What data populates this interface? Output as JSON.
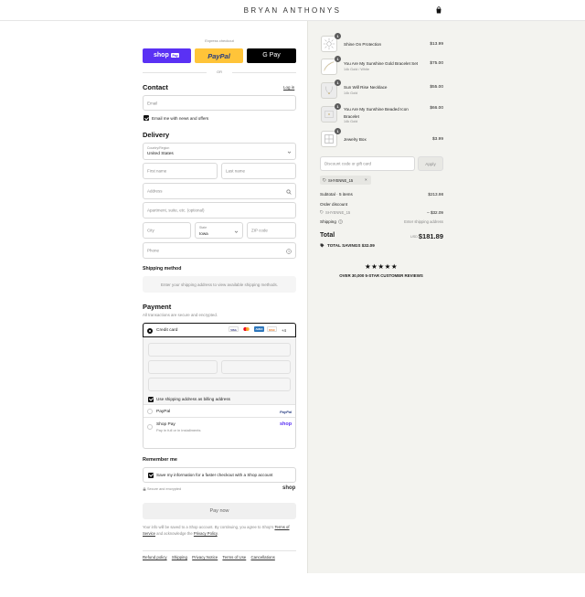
{
  "header": {
    "brand": "BRYAN ANTHONYS",
    "bag_icon": "shopping-bag-icon"
  },
  "express": {
    "label": "Express checkout",
    "shop_pay": "shop",
    "shop_pay_badge": "Pay",
    "paypal": "PayPal",
    "gpay": "G Pay",
    "or": "OR"
  },
  "contact": {
    "title": "Contact",
    "login": "Log in",
    "email_placeholder": "Email",
    "email_news": "Email me with news and offers"
  },
  "delivery": {
    "title": "Delivery",
    "country_label": "Country/Region",
    "country_value": "United States",
    "first_name": "First name",
    "last_name": "Last name",
    "address": "Address",
    "apartment": "Apartment, suite, etc. (optional)",
    "city": "City",
    "state_label": "State",
    "state_value": "Iowa",
    "zip": "ZIP code",
    "phone": "Phone"
  },
  "shipping_method": {
    "title": "Shipping method",
    "notice": "Enter your shipping address to view available shipping methods."
  },
  "payment": {
    "title": "Payment",
    "subtitle": "All transactions are secure and encrypted.",
    "credit_card": "Credit card",
    "card_brands": [
      "VISA",
      "MC",
      "AMEX",
      "DISC"
    ],
    "more_cards": "+4",
    "billing_same": "Use shipping address as billing address",
    "paypal": "PayPal",
    "paypal_logo": "PayPal",
    "shop_pay": "Shop Pay",
    "shop_pay_sub": "Pay in full or in installments",
    "shop_logo": "shop"
  },
  "remember": {
    "title": "Remember me",
    "save_info": "Save my information for a faster checkout with a Shop account",
    "secure": "Secure and encrypted",
    "shop_logo": "shop"
  },
  "pay_now": "Pay now",
  "legal": {
    "line1": "Your info will be saved to a Shop account. By continuing, you agree to Shop's",
    "terms": "Terms of Service",
    "and_ack": "and acknowledge the",
    "privacy": "Privacy Policy",
    "end": "."
  },
  "footer_links": [
    "Refund policy",
    "Shipping",
    "Privacy Notice",
    "Terms of Use",
    "Cancellations"
  ],
  "cart": {
    "items": [
      {
        "qty": "1",
        "name": "Shine On Protection",
        "variant": "",
        "price": "$13.99"
      },
      {
        "qty": "1",
        "name": "You Are My Sunshine Gold Bracelet Set",
        "variant": "14k Gold / White",
        "price": "$75.00"
      },
      {
        "qty": "1",
        "name": "Sun Will Rise Necklace",
        "variant": "14k Gold",
        "price": "$55.00"
      },
      {
        "qty": "1",
        "name": "You Are My Sunshine Beaded Icon Bracelet",
        "variant": "14k Gold",
        "price": "$66.00"
      },
      {
        "qty": "1",
        "name": "Jewelry Box",
        "variant": "",
        "price": "$3.99"
      }
    ],
    "discount_placeholder": "Discount code or gift card",
    "apply": "Apply",
    "applied_code": "SHYENNE_15",
    "subtotal_label": "Subtotal · 5 items",
    "subtotal_value": "$213.98",
    "order_discount_label": "Order discount",
    "discount_code": "SHYENNE_15",
    "discount_value": "– $32.09",
    "shipping_label": "Shipping",
    "shipping_value": "Enter shipping address",
    "total_label": "Total",
    "currency": "USD",
    "total_value": "$181.89",
    "savings_label": "TOTAL SAVINGS",
    "savings_value": "$32.09",
    "stars": "★★★★★",
    "reviews": "OVER 30,000 5-STAR CUSTOMER REVIEWS"
  },
  "colors": {
    "shop_pay": "#5a31f4",
    "paypal": "#ffc439",
    "gpay": "#000000",
    "summary_bg": "#f3f3ef"
  }
}
